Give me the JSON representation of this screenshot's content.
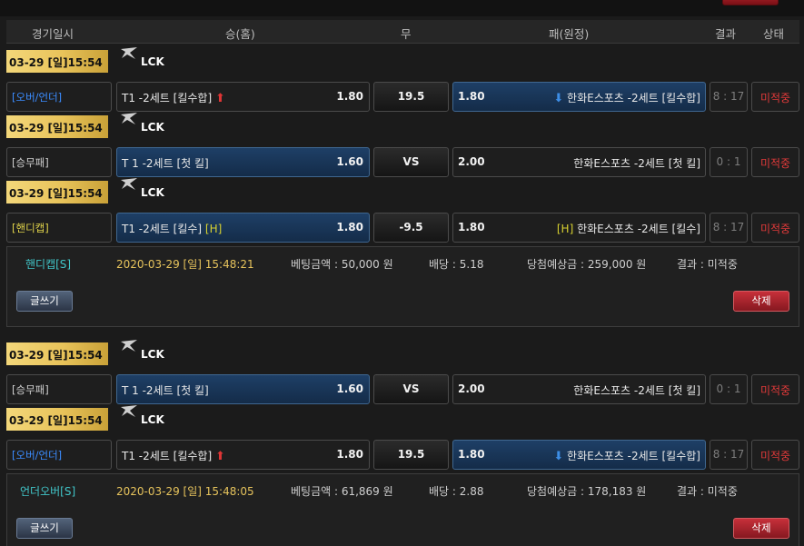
{
  "header": {
    "date": "경기일시",
    "home": "승(홈)",
    "draw": "무",
    "away": "패(원정)",
    "result": "결과",
    "state": "상태"
  },
  "slips": [
    {
      "bets": [
        {
          "date": "03-29 [일]15:54",
          "league": "LCK",
          "type": "[오버/언더]",
          "home": "T1 -2세트 [킬수합]",
          "home_odd": "1.80",
          "draw": "19.5",
          "away_odd": "1.80",
          "away": "한화E스포츠 -2세트 [킬수합]",
          "result": "8 : 17",
          "state": "미적중"
        },
        {
          "date": "03-29 [일]15:54",
          "league": "LCK",
          "type": "[승무패]",
          "home": "T 1 -2세트 [첫 킬]",
          "home_odd": "1.60",
          "draw": "VS",
          "away_odd": "2.00",
          "away": "한화E스포츠 -2세트 [첫 킬]",
          "result": "0 : 1",
          "state": "미적중"
        },
        {
          "date": "03-29 [일]15:54",
          "league": "LCK",
          "type": "[핸디캡]",
          "home": "T1 -2세트 [킬수]",
          "home_mark": "[H]",
          "home_odd": "1.80",
          "draw": "-9.5",
          "away_odd": "1.80",
          "away_mark": "[H]",
          "away": "한화E스포츠 -2세트 [킬수]",
          "result": "8 : 17",
          "state": "미적중"
        }
      ],
      "summary": {
        "type": "핸디캡[S]",
        "datetime": "2020-03-29 [일] 15:48:21",
        "amount": "베팅금액 : 50,000 원",
        "odds": "배당 : 5.18",
        "expected": "당첨예상금 : 259,000 원",
        "result": "결과 : 미적중",
        "write_label": "글쓰기",
        "delete_label": "삭제"
      }
    },
    {
      "bets": [
        {
          "date": "03-29 [일]15:54",
          "league": "LCK",
          "type": "[승무패]",
          "home": "T 1 -2세트 [첫 킬]",
          "home_odd": "1.60",
          "draw": "VS",
          "away_odd": "2.00",
          "away": "한화E스포츠 -2세트 [첫 킬]",
          "result": "0 : 1",
          "state": "미적중"
        },
        {
          "date": "03-29 [일]15:54",
          "league": "LCK",
          "type": "[오버/언더]",
          "home": "T1 -2세트 [킬수합]",
          "home_odd": "1.80",
          "draw": "19.5",
          "away_odd": "1.80",
          "away": "한화E스포츠 -2세트 [킬수합]",
          "result": "8 : 17",
          "state": "미적중"
        }
      ],
      "summary": {
        "type": "언더오버[S]",
        "datetime": "2020-03-29 [일] 15:48:05",
        "amount": "베팅금액 : 61,869 원",
        "odds": "배당 : 2.88",
        "expected": "당첨예상금 : 178,183 원",
        "result": "결과 : 미적중",
        "write_label": "글쓰기",
        "delete_label": "삭제"
      }
    }
  ],
  "colors": {
    "over_under": "#3b8cff",
    "handicap": "#e0d34a",
    "lost": "#e23a3a",
    "selected": "#1e3f66"
  }
}
